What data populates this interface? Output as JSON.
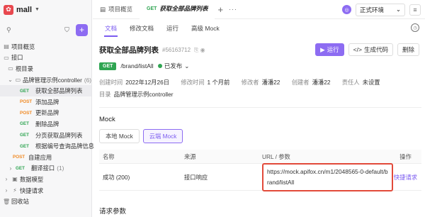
{
  "project": {
    "name": "mall"
  },
  "sidebar": {
    "search_icon": "search-icon",
    "items": [
      {
        "label": "项目概览",
        "icon": "overview-icon"
      },
      {
        "label": "接口",
        "icon": "folder-icon"
      },
      {
        "label": "根目录"
      },
      {
        "label": "品牌管理示例controller",
        "count": "(6)"
      },
      {
        "method": "GET",
        "label": "获取全部品牌列表"
      },
      {
        "method": "POST",
        "label": "添加品牌"
      },
      {
        "method": "POST",
        "label": "更新品牌"
      },
      {
        "method": "GET",
        "label": "删除品牌"
      },
      {
        "method": "GET",
        "label": "分页获取品牌列表"
      },
      {
        "method": "GET",
        "label": "根据编号查询品牌信息"
      },
      {
        "method": "POST",
        "label": "自建应用"
      },
      {
        "method": "GET",
        "label": "翻译接口",
        "count": "(1)"
      },
      {
        "label": "数据模型",
        "icon": "model-icon"
      },
      {
        "label": "快捷请求",
        "icon": "quick-icon"
      },
      {
        "label": "回收站",
        "icon": "trash-icon"
      }
    ]
  },
  "tabs": [
    {
      "label": "项目概览"
    },
    {
      "method": "GET",
      "label": "获取全部品牌列表"
    }
  ],
  "env": {
    "label": "正式环境"
  },
  "subtabs": [
    "文档",
    "修改文档",
    "运行",
    "高级 Mock"
  ],
  "api": {
    "title": "获取全部品牌列表",
    "id": "#56163712",
    "method": "GET",
    "path": "/brand/listAll",
    "status": "已发布",
    "created_label": "创建时间",
    "created": "2022年12月26日",
    "modified_label": "修改时间",
    "modified": "1 个月前",
    "modifier_label": "修改者",
    "modifier": "潘潘22",
    "creator_label": "创建者",
    "creator": "潘潘22",
    "owner_label": "责任人",
    "owner": "未设置",
    "dir_label": "目录",
    "dir": "品牌管理示例controller"
  },
  "actions": {
    "run": "运行",
    "code": "生成代码",
    "delete": "删除"
  },
  "mock": {
    "heading": "Mock",
    "tabs": [
      "本地 Mock",
      "云端 Mock"
    ],
    "columns": [
      "名称",
      "来源",
      "URL / 参数",
      "操作"
    ],
    "rows": [
      {
        "name": "成功 (200)",
        "source": "接口响应",
        "url": "https://mock.apifox.cn/m1/2048565-0-default/brand/listAll",
        "op": "快捷请求"
      }
    ]
  },
  "params_heading": "请求参数",
  "colors": {
    "accent": "#8d6cf2",
    "get": "#2fa552",
    "post": "#f08a24",
    "highlight": "#e24a3a"
  }
}
